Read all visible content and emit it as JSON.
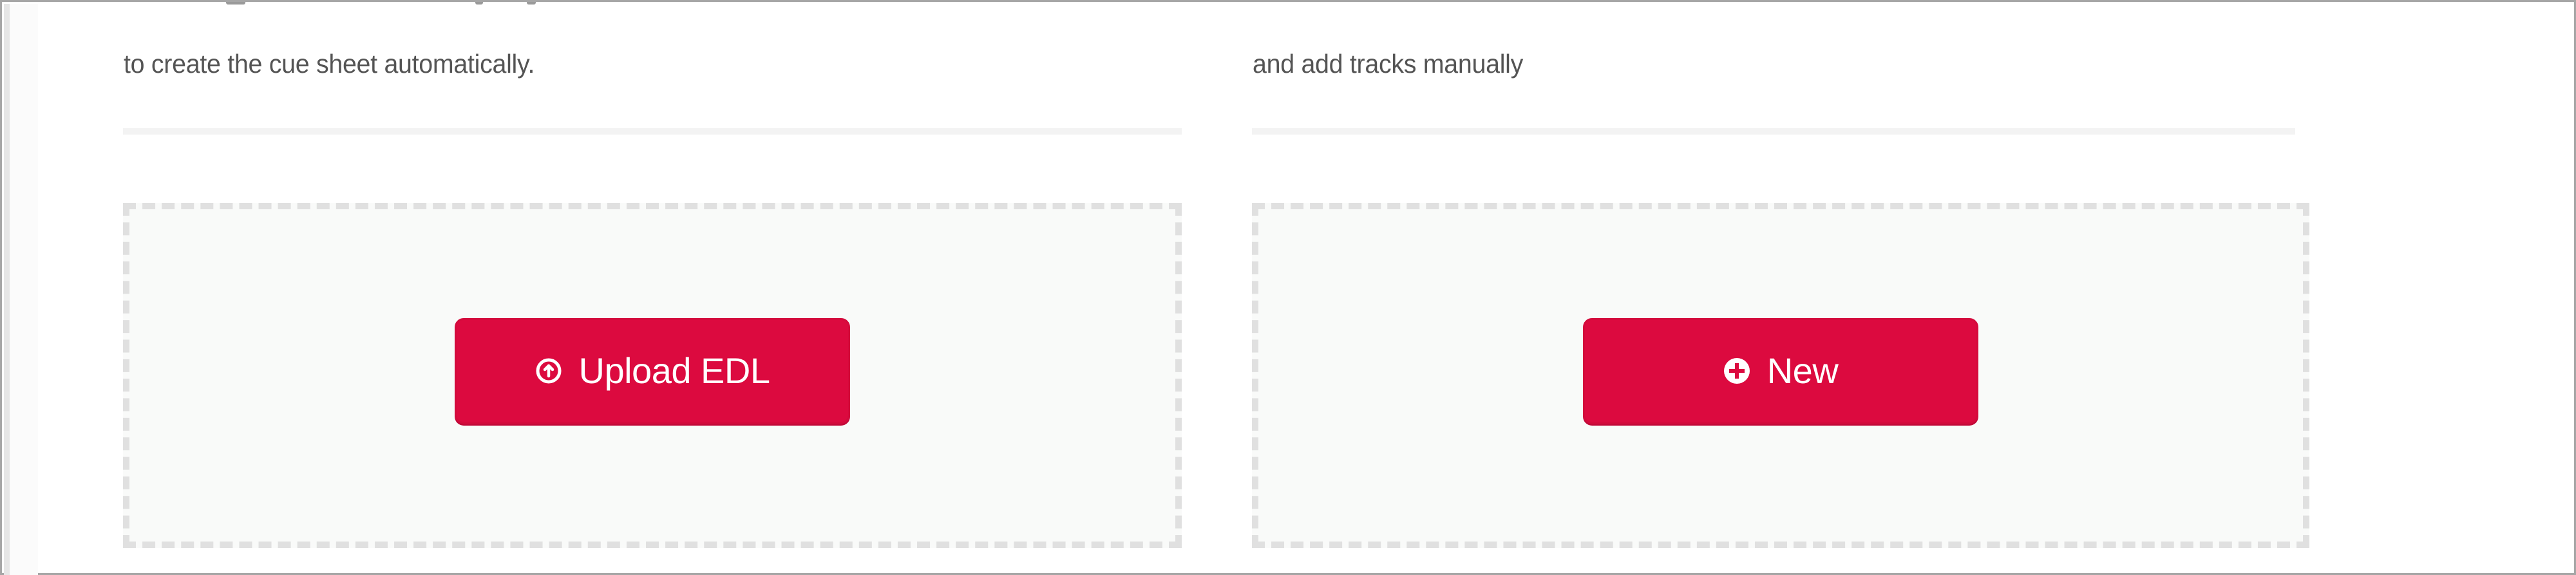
{
  "colors": {
    "accent": "#dc0a3f",
    "description_text": "#545454",
    "dropzone_border": "#e0e0e0",
    "dropzone_background": "#f9faf9",
    "divider": "#f3f3f3"
  },
  "options": [
    {
      "description": "to create the cue sheet automatically.",
      "button": {
        "label": "Upload EDL",
        "icon": "upload-circle-icon"
      }
    },
    {
      "description": "and add tracks manually",
      "button": {
        "label": "New",
        "icon": "plus-circle-icon"
      }
    }
  ]
}
